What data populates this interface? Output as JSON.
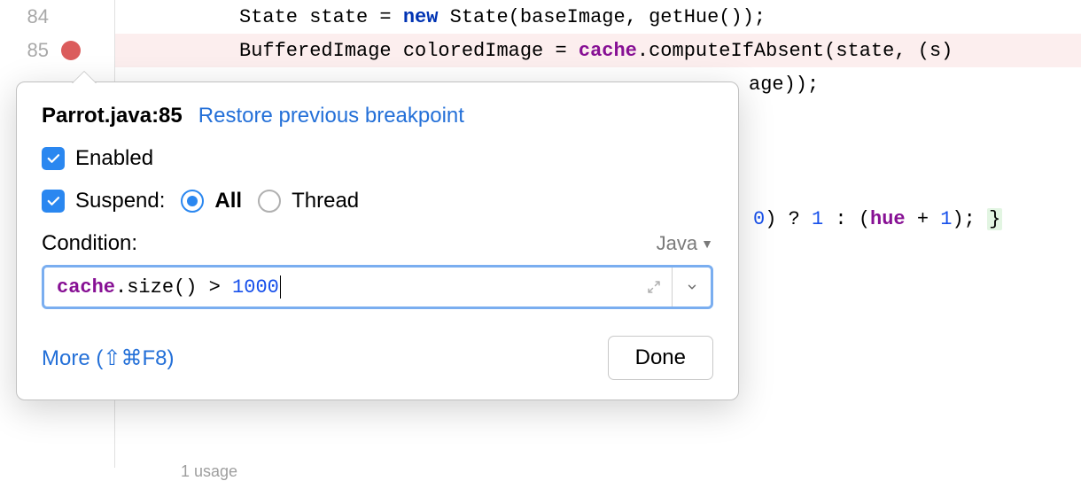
{
  "gutter": {
    "lines": [
      "84",
      "85"
    ]
  },
  "code": {
    "line84": {
      "t1": "State state = ",
      "kw": "new",
      "t2": " State(baseImage, getHue());"
    },
    "line85": {
      "t1": "BufferedImage coloredImage = ",
      "field": "cache",
      "t2": ".computeIfAbsent(state, (s)"
    },
    "line86": {
      "tail": "age));"
    },
    "lineHue": {
      "zero": "0",
      "t1": ") ? ",
      "one": "1",
      "t2": " : (",
      "field": "hue",
      "t3": " + ",
      "one2": "1",
      "t4": "); ",
      "brace": "}"
    }
  },
  "usages": "1 usage",
  "popup": {
    "title": "Parrot.java:85",
    "restore": "Restore previous breakpoint",
    "enabled_label": "Enabled",
    "suspend_label": "Suspend:",
    "suspend_all": "All",
    "suspend_thread": "Thread",
    "condition_label": "Condition:",
    "language": "Java",
    "condition_expr": {
      "field": "cache",
      "t1": ".size() > ",
      "num": "1000"
    },
    "more": "More (⇧⌘F8)",
    "done": "Done"
  }
}
